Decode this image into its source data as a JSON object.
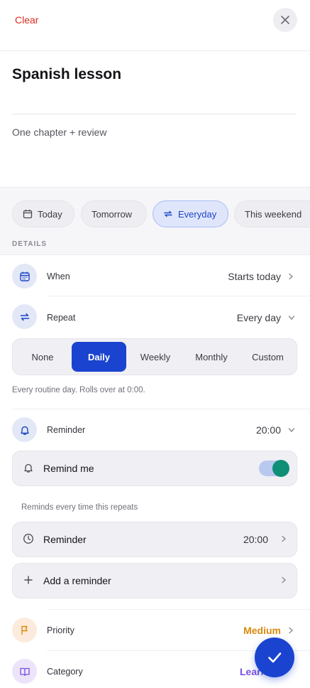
{
  "header": {
    "clear_label": "Clear",
    "close_icon": "close-icon"
  },
  "task": {
    "title": "Spanish lesson",
    "notes": "One chapter + review"
  },
  "quick_chips": [
    {
      "label": "Today",
      "icon": "calendar-icon",
      "active": false
    },
    {
      "label": "Tomorrow",
      "active": false
    },
    {
      "label": "Everyday",
      "icon": "repeat-icon",
      "active": true
    },
    {
      "label": "This weekend",
      "active": false
    }
  ],
  "details": {
    "section_label": "DETAILS",
    "when": {
      "label": "When",
      "value": "Starts today"
    },
    "repeat": {
      "label": "Repeat",
      "value": "Every day",
      "options": [
        "None",
        "Daily",
        "Weekly",
        "Monthly",
        "Custom"
      ],
      "selected": "Daily",
      "help": "Every routine day. Rolls over at 0:00."
    },
    "reminder": {
      "label": "Reminder",
      "value": "20:00",
      "remind_me_label": "Remind me",
      "remind_me_on": true,
      "help": "Reminds every time this repeats",
      "item": {
        "label": "Reminder",
        "time": "20:00"
      },
      "add_label": "Add a reminder"
    },
    "priority": {
      "label": "Priority",
      "value": "Medium",
      "color": "#d98a0b"
    },
    "category": {
      "label": "Category",
      "value": "Learning",
      "visible_value": "Learn",
      "color": "#7b4fe0"
    }
  },
  "colors": {
    "accent": "#1a44cf",
    "danger": "#d92d20",
    "toggle_on": "#0f8f76"
  }
}
